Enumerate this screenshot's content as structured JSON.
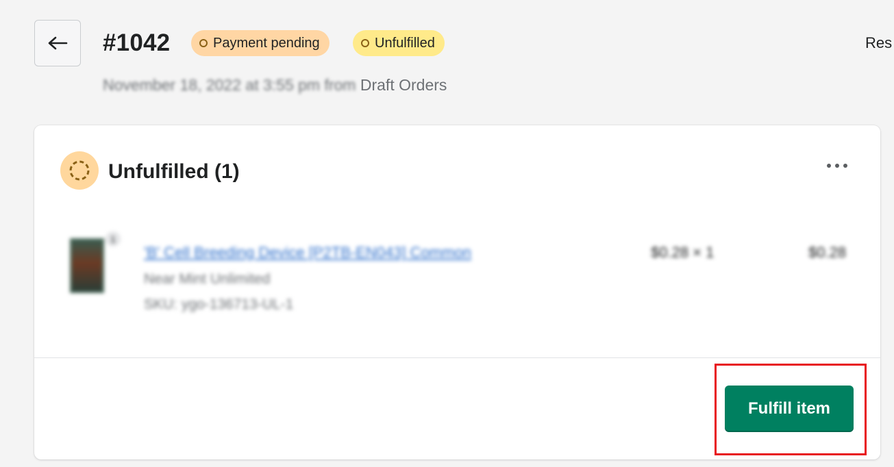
{
  "header": {
    "back_icon": "arrow-left-icon",
    "order_number": "#1042",
    "badges": [
      {
        "label": "Payment pending",
        "color": "#ffd6a4"
      },
      {
        "label": "Unfulfilled",
        "color": "#ffea8a"
      }
    ],
    "right_text": "Res",
    "subtitle_blurred": "November 18, 2022 at 3:55 pm from",
    "subtitle_source": "Draft Orders"
  },
  "card": {
    "status_icon": "unfulfilled-dashed-circle-icon",
    "heading": "Unfulfilled (1)",
    "more_icon": "more-horizontal-icon",
    "line_item": {
      "quantity_badge": "1",
      "title": "'B' Cell Breeding Device [P2TB-EN043] Common",
      "variant": "Near Mint Unlimited",
      "sku": "SKU: ygo-136713-UL-1",
      "price_qty": "$0.28 × 1",
      "total": "$0.28"
    },
    "primary_action": "Fulfill item"
  },
  "colors": {
    "primary": "#008060",
    "highlight": "#e8141b",
    "background": "#f4f4f4"
  }
}
